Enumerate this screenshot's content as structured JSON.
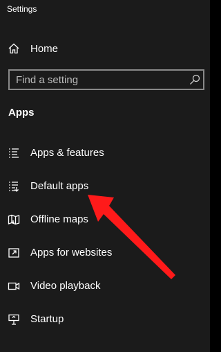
{
  "window": {
    "title": "Settings"
  },
  "home": {
    "label": "Home",
    "icon": "home-icon"
  },
  "search": {
    "placeholder": "Find a setting",
    "value": "",
    "icon": "search-icon"
  },
  "section": {
    "heading": "Apps"
  },
  "menu": {
    "items": [
      {
        "label": "Apps & features",
        "icon": "apps-features-icon"
      },
      {
        "label": "Default apps",
        "icon": "default-apps-icon"
      },
      {
        "label": "Offline maps",
        "icon": "offline-maps-icon"
      },
      {
        "label": "Apps for websites",
        "icon": "apps-for-websites-icon"
      },
      {
        "label": "Video playback",
        "icon": "video-playback-icon"
      },
      {
        "label": "Startup",
        "icon": "startup-icon"
      }
    ]
  },
  "annotation": {
    "arrow_color": "#ff1a1a",
    "points_to": "Default apps"
  },
  "colors": {
    "background": "#1b1b1b",
    "text": "#ffffff",
    "search_border": "#8a8a8a"
  }
}
